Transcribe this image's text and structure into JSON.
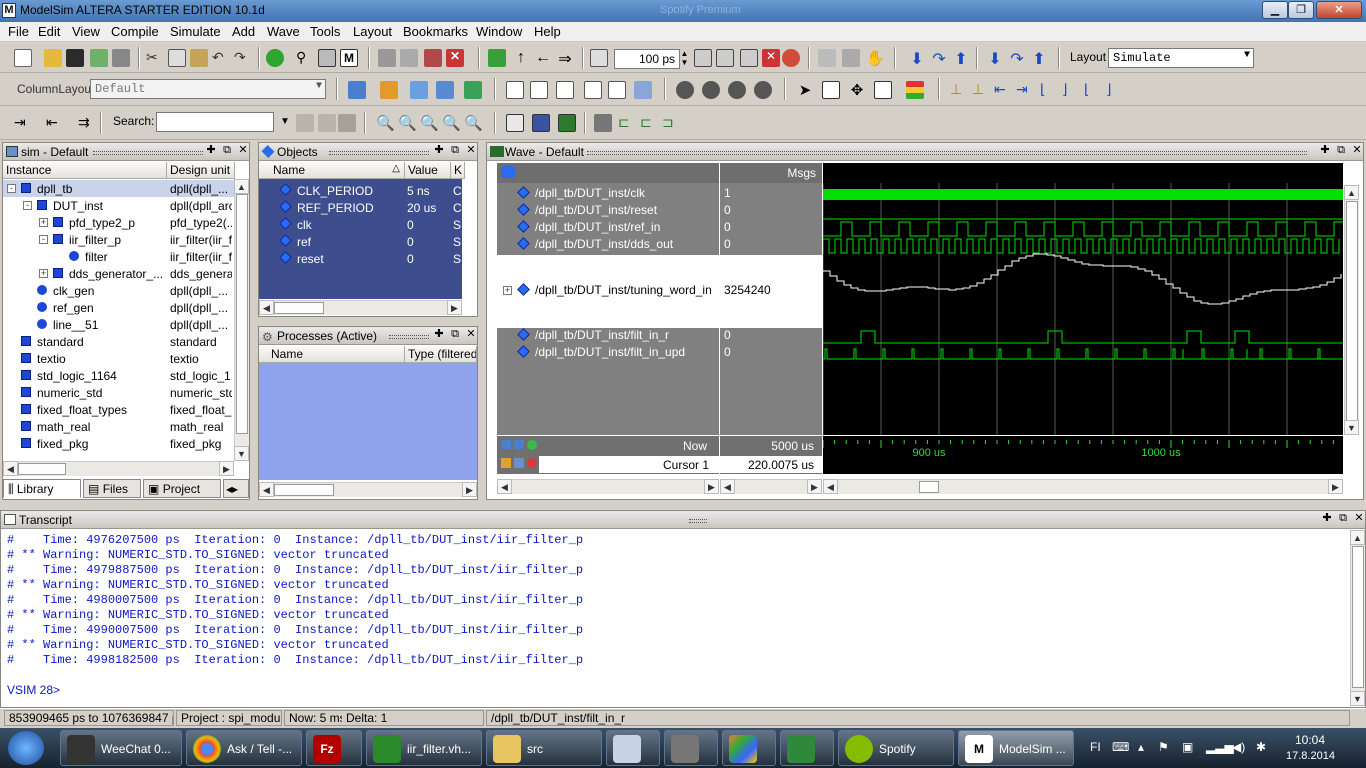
{
  "window": {
    "title": "ModelSim ALTERA STARTER EDITION 10.1d",
    "ghost_title": "Spotify Premium"
  },
  "menu": [
    "File",
    "Edit",
    "View",
    "Compile",
    "Simulate",
    "Add",
    "Wave",
    "Tools",
    "Layout",
    "Bookmarks",
    "Window",
    "Help"
  ],
  "toolbar": {
    "run_length": "100 ps",
    "layout_label": "Layout",
    "layout_value": "Simulate",
    "column_layout_label": "ColumnLayout",
    "column_layout_value": "Default",
    "search_label": "Search:",
    "search_value": ""
  },
  "sim_panel": {
    "title": "sim - Default",
    "columns": [
      "Instance",
      "Design unit"
    ],
    "rows": [
      {
        "name": "dpll_tb",
        "unit": "dpll(dpll_...",
        "indent": 0,
        "icon": "sq",
        "exp": "-"
      },
      {
        "name": "DUT_inst",
        "unit": "dpll(dpll_arch",
        "indent": 1,
        "icon": "sq",
        "exp": "-"
      },
      {
        "name": "pfd_type2_p",
        "unit": "pfd_type2(...",
        "indent": 2,
        "icon": "sq",
        "exp": "+"
      },
      {
        "name": "iir_filter_p",
        "unit": "iir_filter(iir_f...",
        "indent": 2,
        "icon": "sq",
        "exp": "-"
      },
      {
        "name": "filter",
        "unit": "iir_filter(iir_f...",
        "indent": 3,
        "icon": "circ",
        "exp": ""
      },
      {
        "name": "dds_generator_...",
        "unit": "dds_genera...",
        "indent": 2,
        "icon": "sq",
        "exp": "+"
      },
      {
        "name": "clk_gen",
        "unit": "dpll(dpll_...",
        "indent": 1,
        "icon": "circ",
        "exp": ""
      },
      {
        "name": "ref_gen",
        "unit": "dpll(dpll_...",
        "indent": 1,
        "icon": "circ",
        "exp": ""
      },
      {
        "name": "line__51",
        "unit": "dpll(dpll_...",
        "indent": 1,
        "icon": "circ",
        "exp": ""
      },
      {
        "name": "standard",
        "unit": "standard",
        "indent": 0,
        "icon": "sq",
        "exp": ""
      },
      {
        "name": "textio",
        "unit": "textio",
        "indent": 0,
        "icon": "sq",
        "exp": ""
      },
      {
        "name": "std_logic_1164",
        "unit": "std_logic_1...",
        "indent": 0,
        "icon": "sq",
        "exp": ""
      },
      {
        "name": "numeric_std",
        "unit": "numeric_std",
        "indent": 0,
        "icon": "sq",
        "exp": ""
      },
      {
        "name": "fixed_float_types",
        "unit": "fixed_float_...",
        "indent": 0,
        "icon": "sq",
        "exp": ""
      },
      {
        "name": "math_real",
        "unit": "math_real",
        "indent": 0,
        "icon": "sq",
        "exp": ""
      },
      {
        "name": "fixed_pkg",
        "unit": "fixed_pkg",
        "indent": 0,
        "icon": "sq",
        "exp": ""
      }
    ],
    "tabs": [
      "Library",
      "Files",
      "Project"
    ]
  },
  "objects_panel": {
    "title": "Objects",
    "columns": [
      "Name",
      "Value",
      "K"
    ],
    "rows": [
      {
        "name": "CLK_PERIOD",
        "value": "5 ns",
        "k": "C"
      },
      {
        "name": "REF_PERIOD",
        "value": "20 us",
        "k": "C"
      },
      {
        "name": "clk",
        "value": "0",
        "k": "S"
      },
      {
        "name": "ref",
        "value": "0",
        "k": "S"
      },
      {
        "name": "reset",
        "value": "0",
        "k": "S"
      }
    ]
  },
  "processes_panel": {
    "title": "Processes (Active)",
    "columns": [
      "Name",
      "Type (filtered)"
    ]
  },
  "wave_panel": {
    "title": "Wave - Default",
    "msgs_label": "Msgs",
    "signals": [
      {
        "name": "/dpll_tb/DUT_inst/clk",
        "value": "1"
      },
      {
        "name": "/dpll_tb/DUT_inst/reset",
        "value": "0"
      },
      {
        "name": "/dpll_tb/DUT_inst/ref_in",
        "value": "0"
      },
      {
        "name": "/dpll_tb/DUT_inst/dds_out",
        "value": "0"
      },
      {
        "name": "/dpll_tb/DUT_inst/tuning_word_in",
        "value": "3254240"
      },
      {
        "name": "/dpll_tb/DUT_inst/filt_in_r",
        "value": "0"
      },
      {
        "name": "/dpll_tb/DUT_inst/filt_in_upd",
        "value": "0"
      }
    ],
    "now_label": "Now",
    "now_value": "5000 us",
    "cursor_label": "Cursor 1",
    "cursor_value": "220.0075 us",
    "time_labels": [
      "900 us",
      "1000 us"
    ],
    "wave_color": "#00e000"
  },
  "transcript": {
    "title": "Transcript",
    "lines": [
      "#    Time: 4976207500 ps  Iteration: 0  Instance: /dpll_tb/DUT_inst/iir_filter_p",
      "# ** Warning: NUMERIC_STD.TO_SIGNED: vector truncated",
      "#    Time: 4979887500 ps  Iteration: 0  Instance: /dpll_tb/DUT_inst/iir_filter_p",
      "# ** Warning: NUMERIC_STD.TO_SIGNED: vector truncated",
      "#    Time: 4980007500 ps  Iteration: 0  Instance: /dpll_tb/DUT_inst/iir_filter_p",
      "# ** Warning: NUMERIC_STD.TO_SIGNED: vector truncated",
      "#    Time: 4990007500 ps  Iteration: 0  Instance: /dpll_tb/DUT_inst/iir_filter_p",
      "# ** Warning: NUMERIC_STD.TO_SIGNED: vector truncated",
      "#    Time: 4998182500 ps  Iteration: 0  Instance: /dpll_tb/DUT_inst/iir_filter_p"
    ],
    "prompt": "VSIM 28>"
  },
  "status": {
    "range": "853909465 ps to 1076369847 ps",
    "project": "Project : spi_module",
    "now": "Now: 5 ms",
    "delta": "Delta: 1",
    "path": "/dpll_tb/DUT_inst/filt_in_r"
  },
  "taskbar": {
    "items": [
      "WeeChat 0...",
      "Ask / Tell -...",
      "",
      "iir_filter.vh...",
      "src",
      "",
      "",
      "",
      "Spotify",
      "ModelSim ..."
    ],
    "lang": "FI",
    "time": "10:04",
    "date": "17.8.2014"
  }
}
